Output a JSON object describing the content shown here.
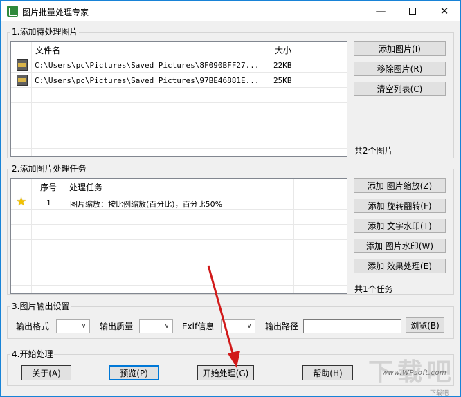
{
  "window": {
    "title": "图片批量处理专家",
    "minimize_glyph": "—",
    "close_glyph": "✕"
  },
  "section1": {
    "legend": "1.添加待处理图片",
    "columns": [
      "文件名",
      "大小"
    ],
    "rows": [
      {
        "name": "C:\\Users\\pc\\Pictures\\Saved Pictures\\8F090BFF27...",
        "size": "22KB",
        "icon": "jpg-file-icon"
      },
      {
        "name": "C:\\Users\\pc\\Pictures\\Saved Pictures\\97BE46881E...",
        "size": "25KB",
        "icon": "jpg-file-icon"
      }
    ],
    "buttons": {
      "add": "添加图片(I)",
      "remove": "移除图片(R)",
      "clear": "清空列表(C)"
    },
    "count": "共2个图片"
  },
  "section2": {
    "legend": "2.添加图片处理任务",
    "columns": [
      "序号",
      "处理任务"
    ],
    "rows": [
      {
        "index": "1",
        "task": "图片缩放：按比例缩放(百分比)，百分比50%",
        "icon": "star-icon"
      }
    ],
    "buttons": {
      "zoom": "添加 图片缩放(Z)",
      "rotate": "添加 旋转翻转(F)",
      "text_wm": "添加 文字水印(T)",
      "img_wm": "添加 图片水印(W)",
      "effect": "添加 效果处理(E)"
    },
    "count": "共1个任务"
  },
  "section3": {
    "legend": "3.图片输出设置",
    "format_label": "输出格式",
    "format_value": "",
    "quality_label": "输出质量",
    "quality_value": "",
    "exif_label": "Exif信息",
    "exif_value": "",
    "path_label": "输出路径",
    "path_value": "",
    "browse": "浏览(B)"
  },
  "section4": {
    "legend": "4.开始处理",
    "about": "关于(A)",
    "preview": "预览(P)",
    "start": "开始处理(G)",
    "help": "帮助(H)"
  },
  "watermark": {
    "logo": "下载吧",
    "url": "www.WPsoft.com",
    "sub": "下载吧"
  },
  "colors": {
    "accent_border": "#0078d7",
    "arrow": "#d11a1a",
    "window_bg": "#f0f0f0"
  }
}
